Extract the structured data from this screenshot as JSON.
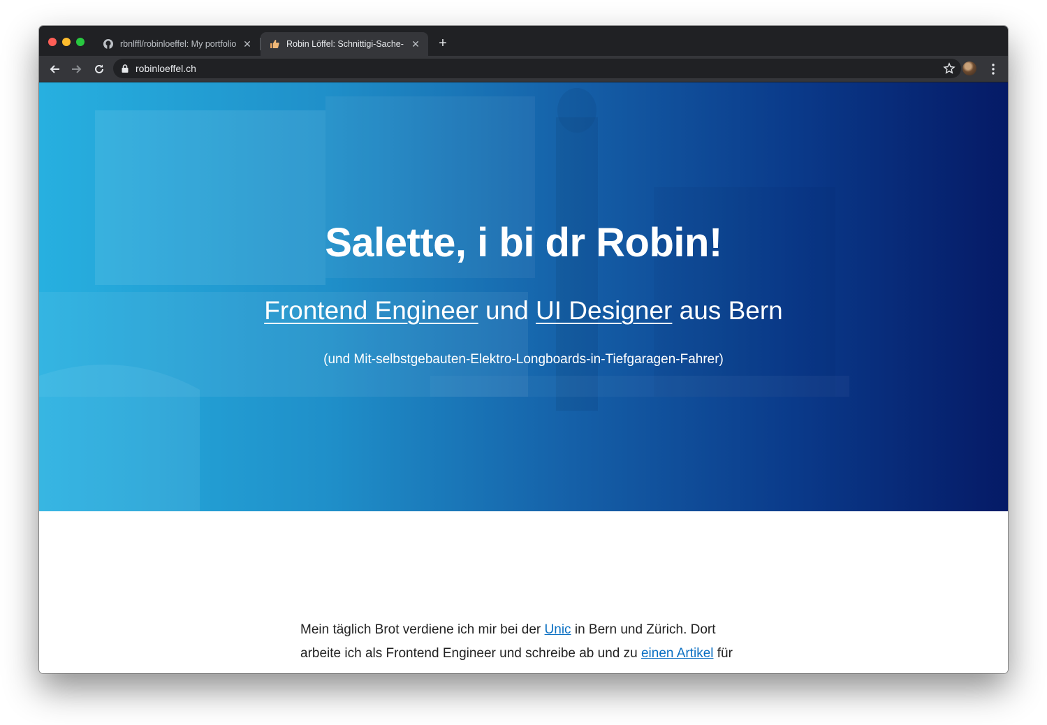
{
  "browser": {
    "tabs": [
      {
        "title": "rbnlffl/robinloeffel: My portfolio",
        "icon": "github-icon"
      },
      {
        "title": "Robin Löffel: Schnittigi-Sache-",
        "icon": "thumbs-up-icon"
      }
    ],
    "new_tab_label": "+",
    "url": "robinloeffel.ch",
    "colors": {
      "tabstrip": "#202124",
      "toolbar": "#35363a"
    }
  },
  "hero": {
    "title": "Salette, i bi dr Robin!",
    "subtitle": {
      "link1": "Frontend Engineer",
      "mid": " und ",
      "link2": "UI Designer",
      "end": " aus Bern"
    },
    "note": "(und Mit-selbstgebauten-Elektro-Longboards-in-Tiefgaragen-Fahrer)",
    "colors": {
      "start": "#27b0e0",
      "end": "#051a66"
    }
  },
  "content": {
    "line1_pre": "Mein täglich Brot verdiene ich mir bei der ",
    "line1_link": "Unic",
    "line1_post": " in Bern und Zürich. Dort",
    "line2_pre": "arbeite ich als Frontend Engineer und schreibe ab und zu ",
    "line2_link": "einen Artikel",
    "line2_post": " für",
    "link_color": "#0a6fc2"
  }
}
